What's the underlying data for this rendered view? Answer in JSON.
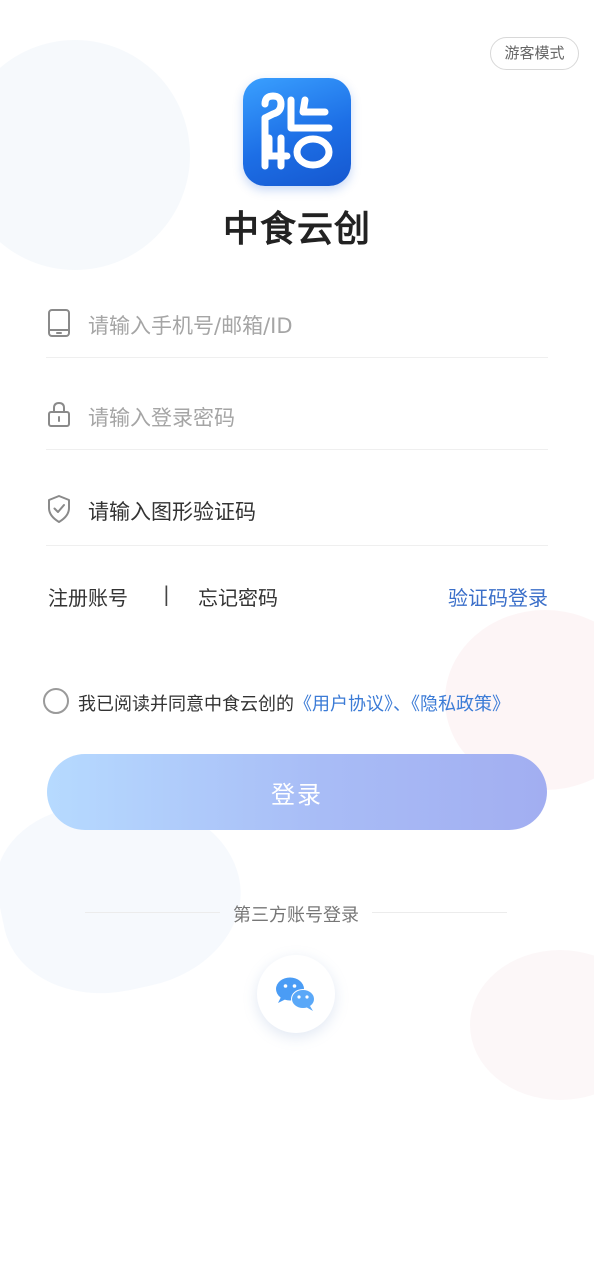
{
  "header": {
    "guest_mode_label": "游客模式"
  },
  "app": {
    "name": "中食云创"
  },
  "form": {
    "account": {
      "placeholder": "请输入手机号/邮箱/ID",
      "icon": "phone-icon"
    },
    "password": {
      "placeholder": "请输入登录密码",
      "icon": "lock-icon"
    },
    "captcha": {
      "placeholder": "请输入图形验证码",
      "icon": "shield-icon"
    }
  },
  "links": {
    "register": "注册账号",
    "separator": "|",
    "forgot_password": "忘记密码",
    "code_login": "验证码登录"
  },
  "agreement": {
    "prefix": "我已阅读并同意中食云创的",
    "user_agreement": "《用户协议》",
    "separator": "、",
    "privacy_policy": "《隐私政策》",
    "checked": false
  },
  "login_button": {
    "label": "登录"
  },
  "third_party": {
    "label": "第三方账号登录",
    "providers": [
      "wechat-icon"
    ]
  },
  "colors": {
    "link_blue": "#3b6fc9",
    "logo_blue": "#1d6fe6",
    "button_gradient_start": "#b6daff",
    "button_gradient_end": "#a2aef1",
    "wechat_blue": "#4a9cf5"
  }
}
